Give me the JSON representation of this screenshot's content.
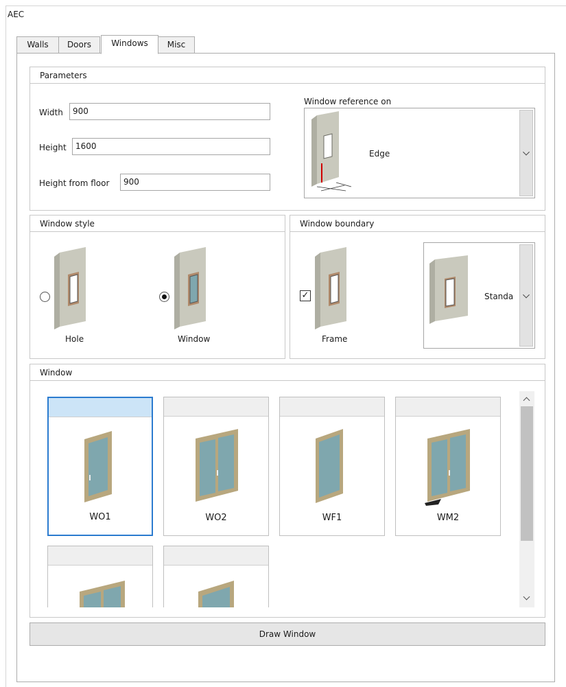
{
  "window": {
    "title": "AEC"
  },
  "tabs": [
    {
      "label": "Walls"
    },
    {
      "label": "Doors"
    },
    {
      "label": "Windows",
      "active": true
    },
    {
      "label": "Misc"
    }
  ],
  "parameters": {
    "header": "Parameters",
    "width_label": "Width",
    "width_value": "900",
    "height_label": "Height",
    "height_value": "1600",
    "height_from_floor_label": "Height from floor",
    "height_from_floor_value": "900",
    "reference_label": "Window reference on",
    "reference_value": "Edge"
  },
  "window_style": {
    "header": "Window style",
    "options": [
      {
        "label": "Hole",
        "selected": false
      },
      {
        "label": "Window",
        "selected": true
      }
    ]
  },
  "window_boundary": {
    "header": "Window boundary",
    "frame_label": "Frame",
    "frame_checked": true,
    "boundary_value": "Standa"
  },
  "window_list": {
    "header": "Window",
    "items": [
      {
        "name": "WO1",
        "selected": true
      },
      {
        "name": "WO2",
        "selected": false
      },
      {
        "name": "WF1",
        "selected": false
      },
      {
        "name": "WM2",
        "selected": false
      },
      {
        "name": "",
        "selected": false
      },
      {
        "name": "",
        "selected": false
      }
    ]
  },
  "actions": {
    "draw_label": "Draw Window"
  },
  "colors": {
    "accent": "#2b7bcf",
    "selected_tile_header": "#cce4f7",
    "wall": "#c9c9bd",
    "window_frame": "#b8a77e",
    "glass": "#7fa7ae"
  }
}
